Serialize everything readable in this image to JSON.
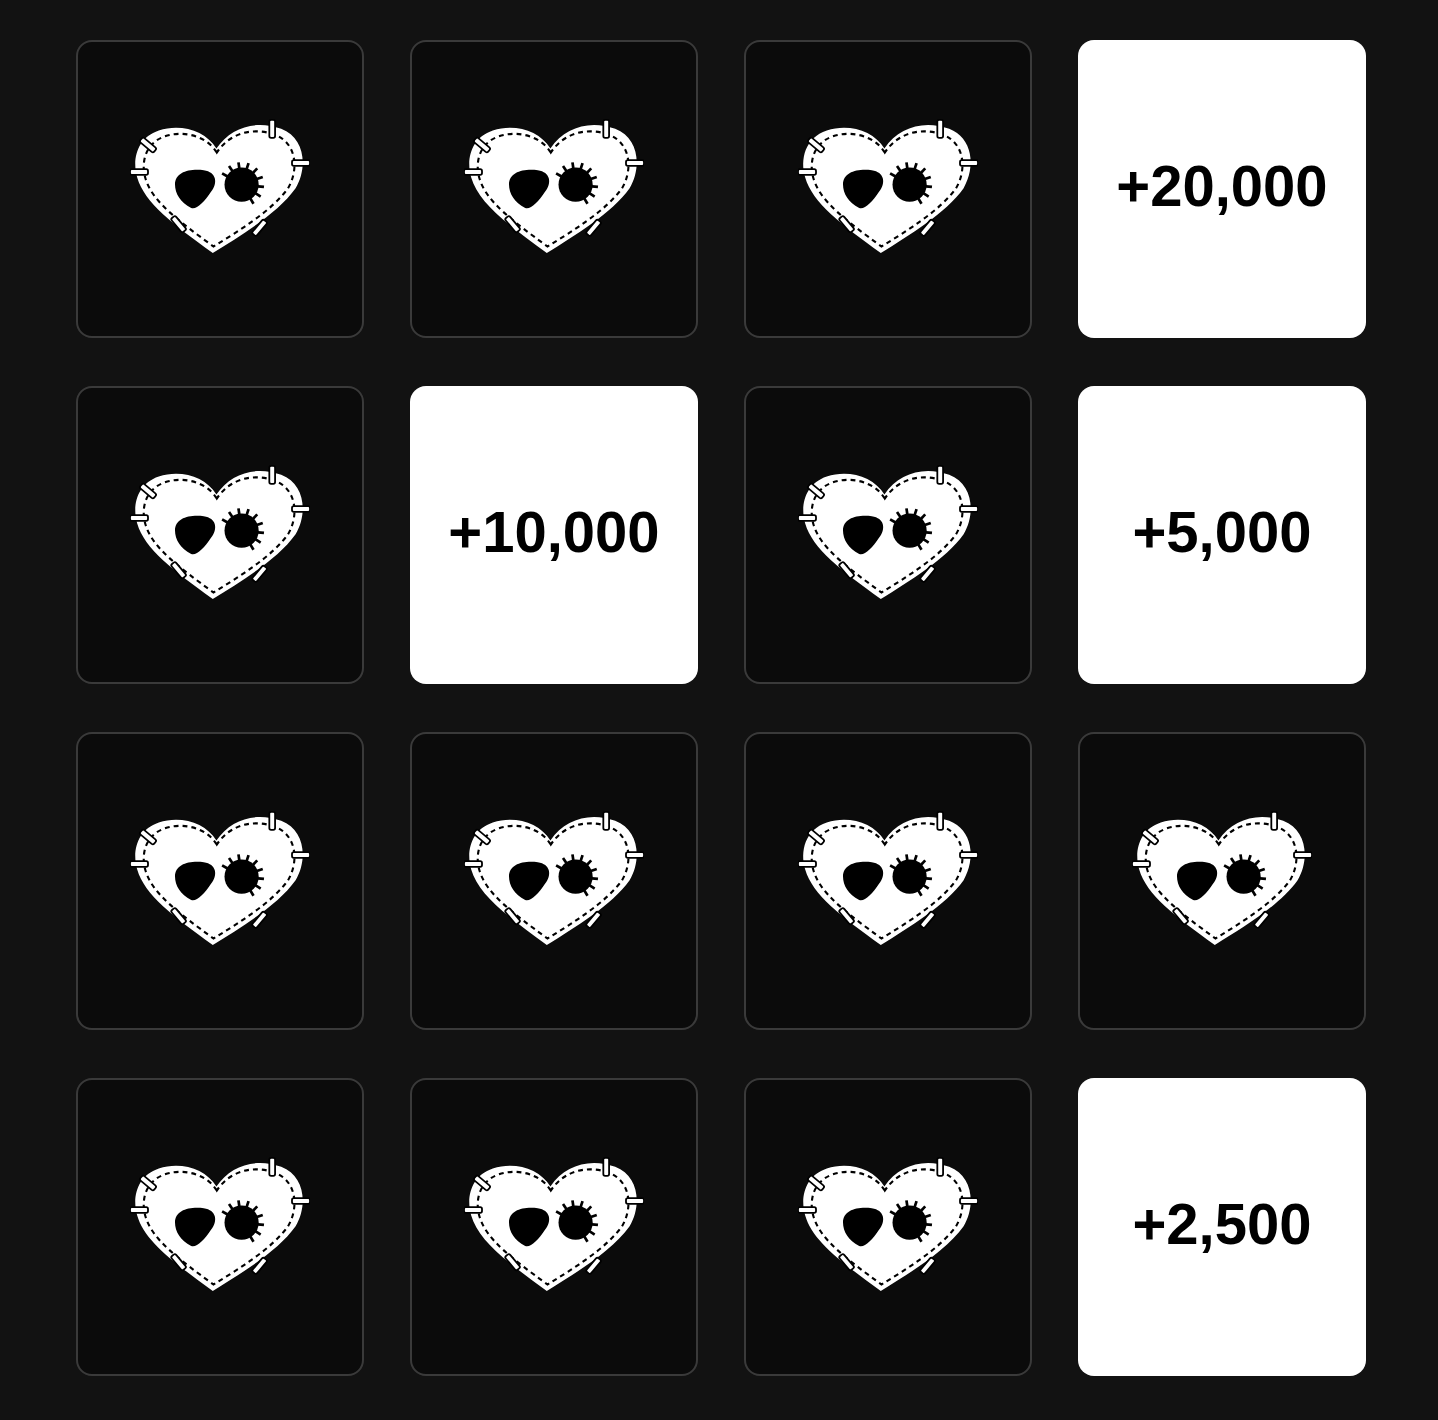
{
  "cards": [
    {
      "kind": "hidden"
    },
    {
      "kind": "hidden"
    },
    {
      "kind": "hidden"
    },
    {
      "kind": "prize",
      "value": "+20,000"
    },
    {
      "kind": "hidden"
    },
    {
      "kind": "prize",
      "value": "+10,000"
    },
    {
      "kind": "hidden"
    },
    {
      "kind": "prize",
      "value": "+5,000"
    },
    {
      "kind": "hidden"
    },
    {
      "kind": "hidden"
    },
    {
      "kind": "hidden"
    },
    {
      "kind": "hidden"
    },
    {
      "kind": "hidden"
    },
    {
      "kind": "hidden"
    },
    {
      "kind": "hidden"
    },
    {
      "kind": "prize",
      "value": "+2,500"
    }
  ]
}
